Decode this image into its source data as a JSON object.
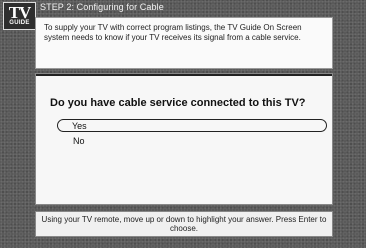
{
  "brand": {
    "logo_line1": "TV",
    "logo_line2": "GUIDE"
  },
  "header": {
    "title": "STEP 2: Configuring for Cable"
  },
  "intro": {
    "text": "To supply your TV with correct program listings, the TV Guide On Screen system needs to know if your TV receives its signal from a cable service."
  },
  "question": {
    "text": "Do you have cable service connected to this TV?",
    "options": [
      "Yes",
      "No"
    ],
    "selected": "Yes"
  },
  "footer": {
    "help_text": "Using your TV remote, move up or down to highlight your answer. Press Enter to choose."
  }
}
